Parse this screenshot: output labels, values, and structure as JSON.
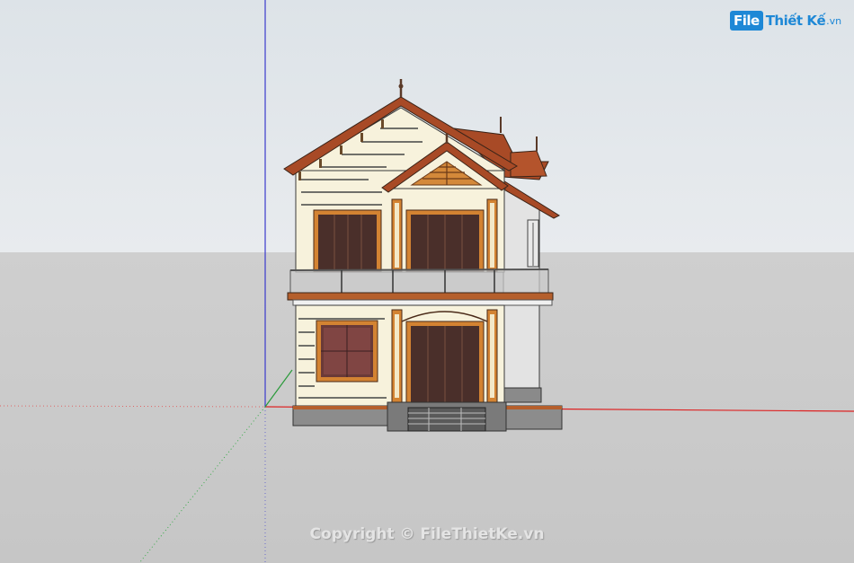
{
  "watermark": {
    "logo_file": "File",
    "logo_rest": "Thiết Kế",
    "logo_tld": ".vn",
    "copyright": "Copyright © FileThietKe.vn"
  },
  "colors": {
    "sky": "#dde3e8",
    "ground": "#c8c8c8",
    "roof": "#a84a26",
    "wall": "#f7f2dc",
    "trim": "#c87a2c",
    "window": "#4a2f2a",
    "x_axis": "#d22",
    "y_axis": "#2a9a3a",
    "z_axis": "#3a3acc",
    "logo": "#1e88d6"
  },
  "scene": {
    "subject": "two-storey-house-model",
    "axes": [
      "red-axis",
      "green-axis",
      "blue-axis"
    ]
  }
}
